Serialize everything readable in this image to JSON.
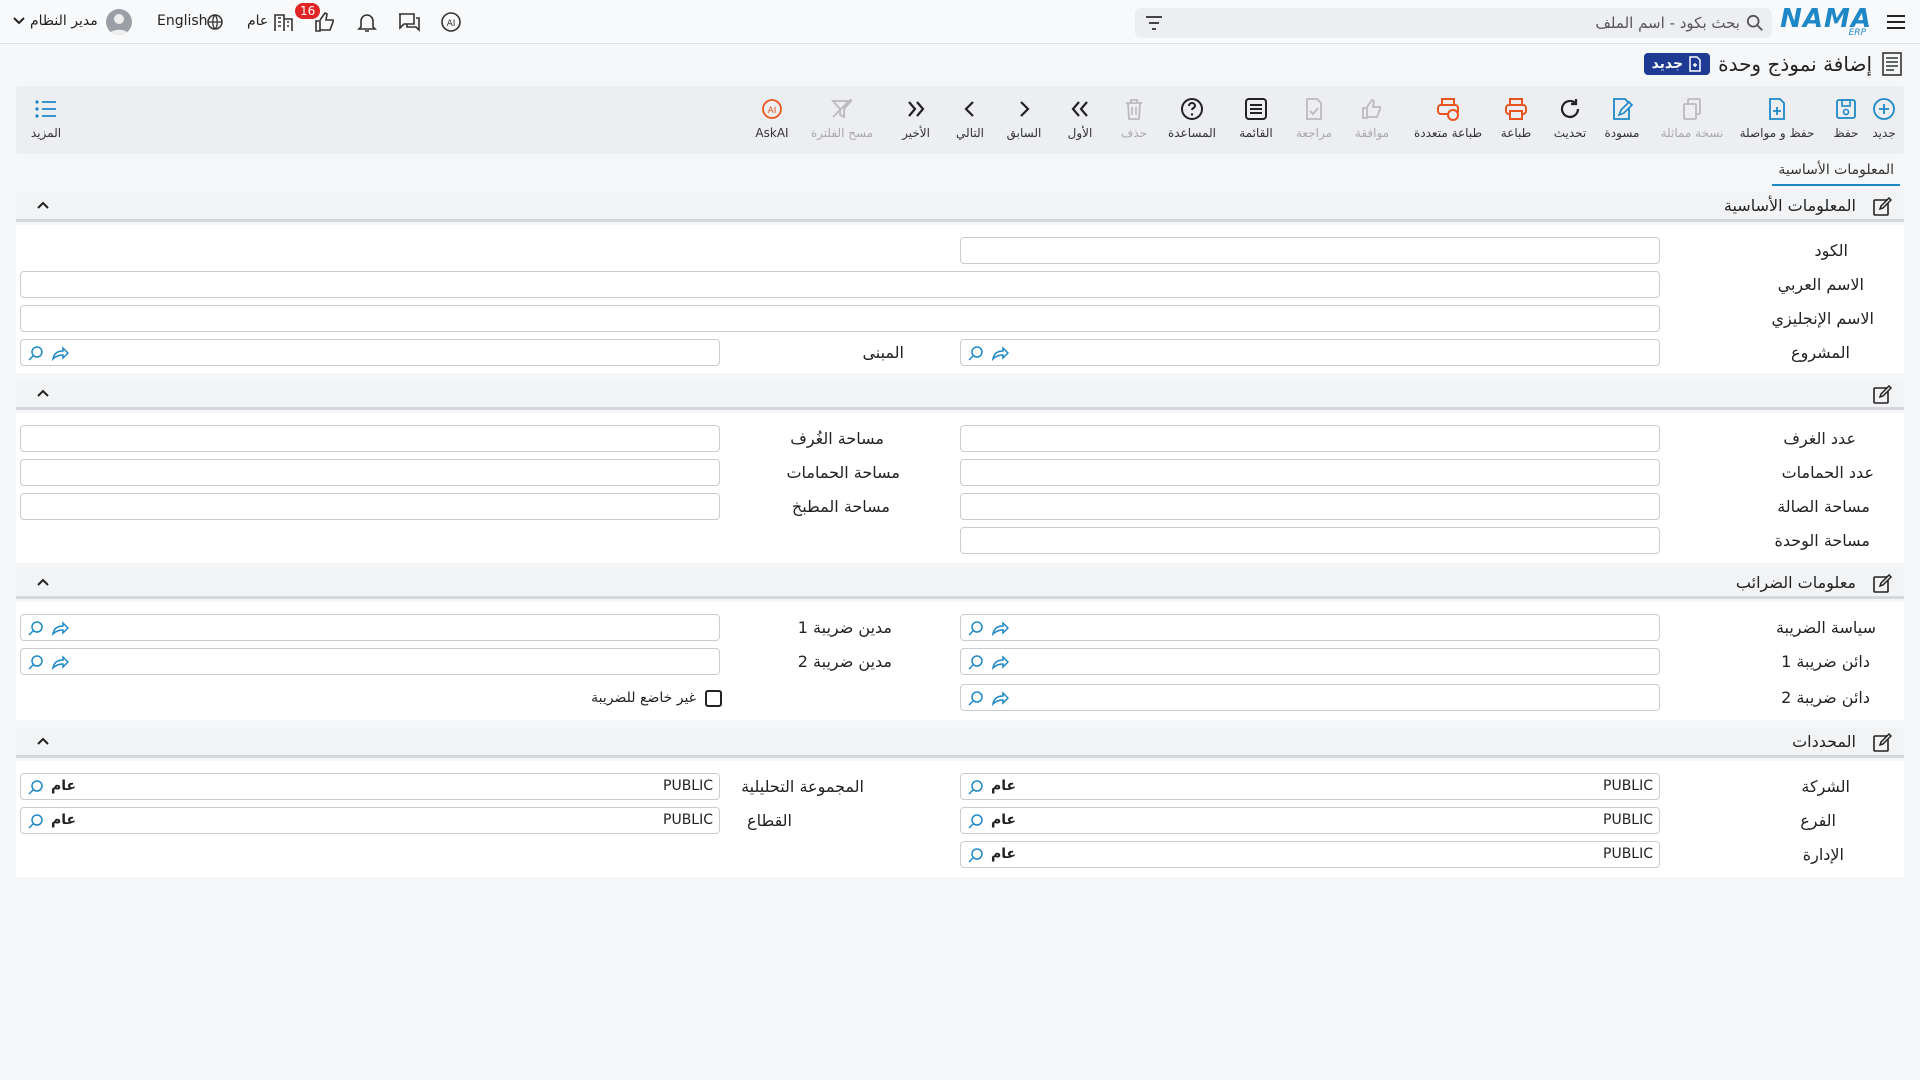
{
  "topbar": {
    "logo_text": "NAMA",
    "logo_sub": "ERP",
    "search_placeholder": "بحث بكود - اسم الملف",
    "notification_count": "16",
    "general_label": "عام",
    "language_label": "English",
    "user_name": "مدير النظام"
  },
  "page": {
    "title": "إضافة نموذج وحدة",
    "new_badge": "جديد"
  },
  "toolbar": {
    "new": "جديد",
    "save": "حفظ",
    "save_continue": "حفظ و مواصلة",
    "copy": "نسخة مماثلة",
    "draft": "مسودة",
    "refresh": "تحديث",
    "print": "طباعة",
    "multi_print": "طباعة متعددة",
    "approve": "موافقة",
    "review": "مراجعة",
    "list": "القائمة",
    "help": "المساعدة",
    "delete": "حذف",
    "first": "الأول",
    "prev": "السابق",
    "next": "التالي",
    "last": "الأخير",
    "clear_filter": "مسح الفلترة",
    "askai": "AskAI",
    "more": "المزيد"
  },
  "tabs": {
    "basic": "المعلومات الأساسية"
  },
  "basic": {
    "title": "المعلومات الأساسية",
    "code": "الكود",
    "arabic_name": "الاسم العربي",
    "english_name": "الاسم الإنجليزي",
    "project": "المشروع",
    "building": "المبنى"
  },
  "details": {
    "rooms_count": "عدد الغرف",
    "rooms_area": "مساحة الغُرف",
    "baths_count": "عدد الحمامات",
    "baths_area": "مساحة الحمامات",
    "hall_area": "مساحة الصالة",
    "kitchen_area": "مساحة المطبخ",
    "unit_area": "مساحة الوحدة"
  },
  "tax": {
    "title": "معلومات الضرائب",
    "policy": "سياسة الضريبة",
    "debtor1": "مدين ضريبة 1",
    "creditor1": "دائن ضريبة 1",
    "debtor2": "مدين ضريبة 2",
    "creditor2": "دائن ضريبة 2",
    "not_taxable": "غير خاضع للضريبة"
  },
  "dims": {
    "title": "المحددات",
    "company": "الشركة",
    "analysis_group": "المجموعة التحليلية",
    "branch": "الفرع",
    "sector": "القطاع",
    "department": "الإدارة",
    "value": "PUBLIC",
    "general": "عام"
  },
  "colors": {
    "accent": "#1e88c7",
    "badge_red": "#e02424",
    "new_badge": "#1f3a93",
    "print_orange": "#e8541e"
  }
}
